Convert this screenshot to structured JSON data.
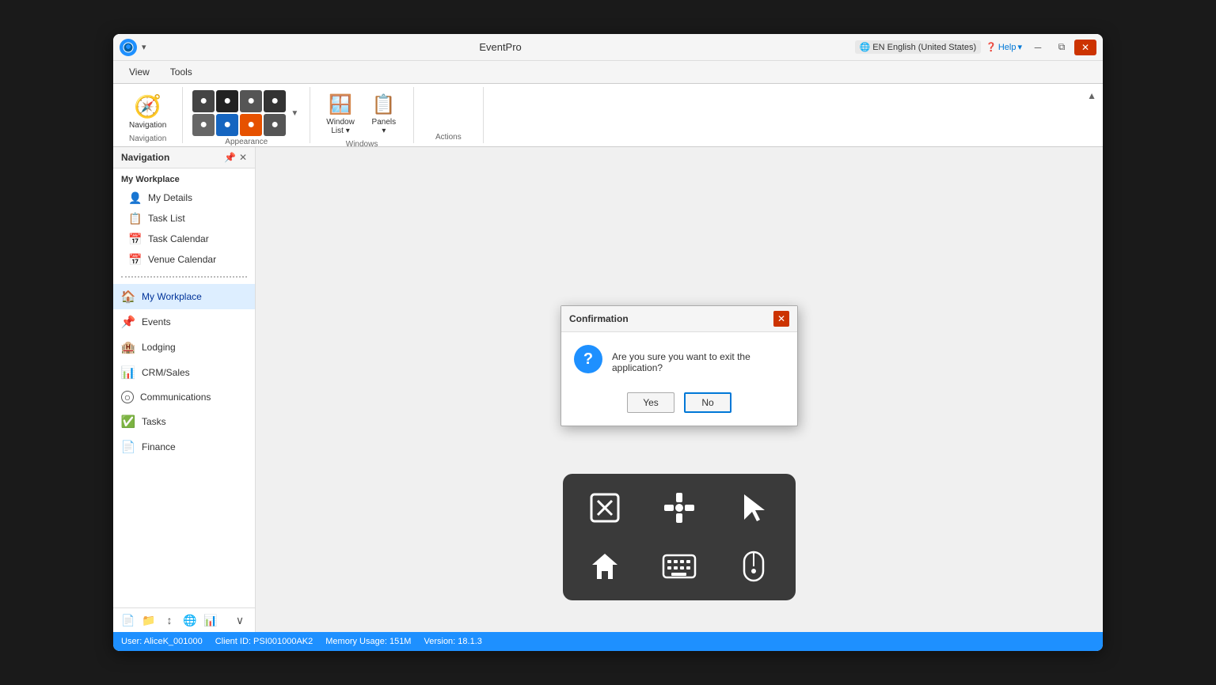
{
  "titlebar": {
    "app_title": "EventPro",
    "lang": "EN English (United States)",
    "help": "Help"
  },
  "ribbon": {
    "tabs": [
      "View",
      "Tools"
    ],
    "active_tab": "View",
    "groups": [
      {
        "label": "Navigation",
        "buttons": [
          {
            "label": "Navigation",
            "icon": "🧭"
          }
        ]
      },
      {
        "label": "Appearance",
        "small_buttons": [
          "●",
          "◉",
          "◈",
          "◉",
          "◈",
          "◉",
          "◉",
          "◉"
        ]
      },
      {
        "label": "Windows",
        "buttons": [
          {
            "label": "Window List ▾",
            "icon": "🪟"
          },
          {
            "label": "Panels ▾",
            "icon": "📋"
          }
        ]
      },
      {
        "label": "Actions",
        "buttons": []
      }
    ]
  },
  "sidebar": {
    "title": "Navigation",
    "section": "My Workplace",
    "items": [
      {
        "label": "My Details",
        "icon": "👤"
      },
      {
        "label": "Task List",
        "icon": "📋"
      },
      {
        "label": "Task Calendar",
        "icon": "📅"
      },
      {
        "label": "Venue Calendar",
        "icon": "📅"
      }
    ],
    "nav_items": [
      {
        "label": "My Workplace",
        "icon": "🏠",
        "active": true
      },
      {
        "label": "Events",
        "icon": "📌"
      },
      {
        "label": "Lodging",
        "icon": "🏨"
      },
      {
        "label": "CRM/Sales",
        "icon": "📊"
      },
      {
        "label": "Communications",
        "icon": "○"
      },
      {
        "label": "Tasks",
        "icon": "✅"
      },
      {
        "label": "Finance",
        "icon": "📄"
      }
    ],
    "bottom_icons": [
      "📄",
      "📁",
      "↕",
      "🌐",
      "📊"
    ]
  },
  "dialog": {
    "title": "Confirmation",
    "message": "Are you sure you want to exit the application?",
    "yes_label": "Yes",
    "no_label": "No"
  },
  "status_bar": {
    "user": "User: AliceK_001000",
    "client": "Client ID: PSI001000AK2",
    "memory": "Memory Usage: 151M",
    "version": "Version: 18.1.3"
  }
}
